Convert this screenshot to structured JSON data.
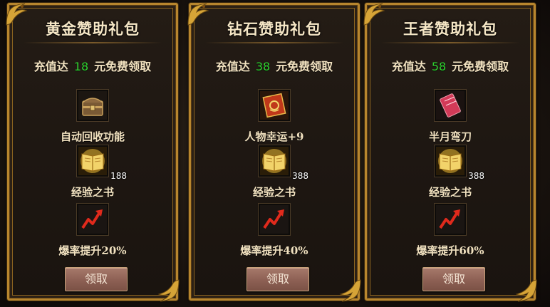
{
  "packs": [
    {
      "title": "黄金赞助礼包",
      "req_prefix": "充值达",
      "req_amount": "18",
      "req_suffix": "元免费领取",
      "items": [
        {
          "icon": "treasure-chest-icon",
          "name": "自动回收功能",
          "count": ""
        },
        {
          "icon": "experience-book-icon",
          "name": "经验之书",
          "count": "188"
        },
        {
          "icon": "red-arrow-up-icon",
          "name": "爆率提升20%",
          "count": ""
        }
      ],
      "button": "领取"
    },
    {
      "title": "钻石赞助礼包",
      "req_prefix": "充值达",
      "req_amount": "38",
      "req_suffix": "元免费领取",
      "items": [
        {
          "icon": "fortune-scroll-icon",
          "name": "人物幸运+9",
          "count": ""
        },
        {
          "icon": "experience-book-icon",
          "name": "经验之书",
          "count": "388"
        },
        {
          "icon": "red-arrow-up-icon",
          "name": "爆率提升40%",
          "count": ""
        }
      ],
      "button": "领取"
    },
    {
      "title": "王者赞助礼包",
      "req_prefix": "充值达",
      "req_amount": "58",
      "req_suffix": "元免费领取",
      "items": [
        {
          "icon": "half-moon-blade-icon",
          "name": "半月弯刀",
          "count": ""
        },
        {
          "icon": "experience-book-icon",
          "name": "经验之书",
          "count": "388"
        },
        {
          "icon": "red-arrow-up-icon",
          "name": "爆率提升60%",
          "count": ""
        }
      ],
      "button": "领取"
    }
  ],
  "colors": {
    "frame_gold": "#b8862e",
    "amount_green": "#31d431",
    "text_cream": "#f2e2c0",
    "button_brown": "#8f6256"
  }
}
